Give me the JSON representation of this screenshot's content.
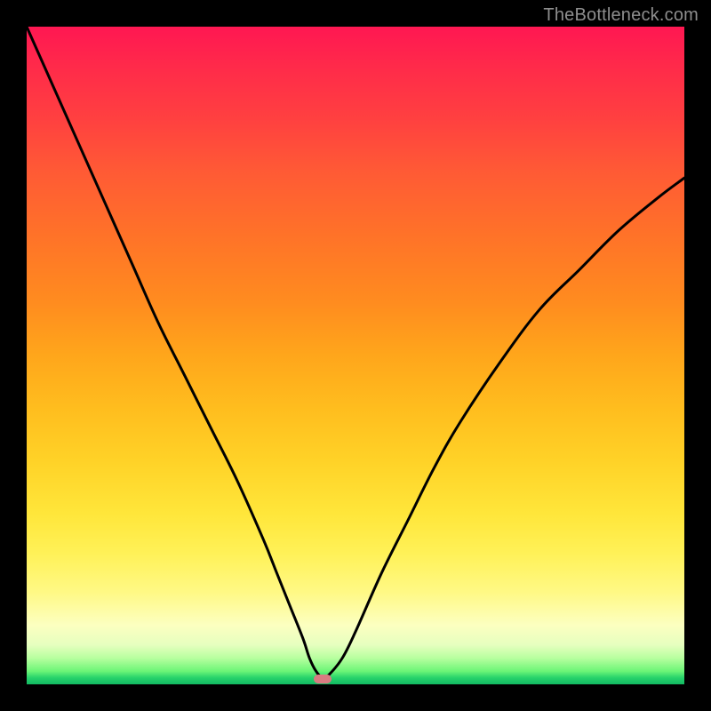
{
  "watermark": "TheBottleneck.com",
  "chart_data": {
    "type": "line",
    "title": "",
    "xlabel": "",
    "ylabel": "",
    "xlim": [
      0,
      100
    ],
    "ylim": [
      0,
      100
    ],
    "series": [
      {
        "name": "bottleneck-curve",
        "x": [
          0,
          4,
          8,
          12,
          16,
          20,
          24,
          28,
          32,
          36,
          38,
          40,
          42,
          43,
          44,
          45,
          46,
          48,
          50,
          54,
          58,
          62,
          66,
          72,
          78,
          84,
          90,
          96,
          100
        ],
        "values": [
          100,
          91,
          82,
          73,
          64,
          55,
          47,
          39,
          31,
          22,
          17,
          12,
          7,
          4,
          2,
          1,
          1.5,
          4,
          8,
          17,
          25,
          33,
          40,
          49,
          57,
          63,
          69,
          74,
          77
        ]
      }
    ],
    "min_marker": {
      "x": 45,
      "y": 0.8
    },
    "gradient_stops": [
      {
        "pos": 0,
        "color": "#ff1752"
      },
      {
        "pos": 50,
        "color": "#ffa61b"
      },
      {
        "pos": 80,
        "color": "#fff157"
      },
      {
        "pos": 100,
        "color": "#12b862"
      }
    ]
  }
}
